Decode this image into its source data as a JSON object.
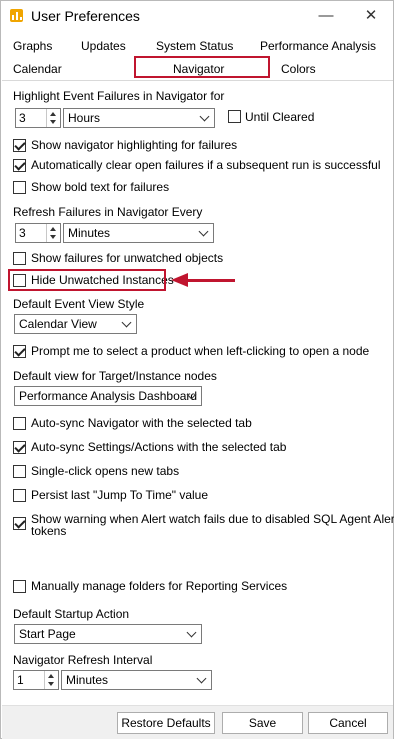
{
  "window": {
    "title": "User Preferences",
    "minimize": "—",
    "close": "✕"
  },
  "tabs": {
    "row1": [
      "Graphs",
      "Updates",
      "System Status",
      "Performance Analysis"
    ],
    "row2": [
      "Calendar",
      "Navigator",
      "Colors"
    ],
    "active": "Navigator"
  },
  "highlight_failures": {
    "label": "Highlight Event Failures in Navigator for",
    "number": "3",
    "unit": "Hours",
    "until_cleared": "Until Cleared",
    "until_cleared_checked": false
  },
  "options_a": [
    {
      "label": "Show navigator highlighting for failures",
      "checked": true
    },
    {
      "label": "Automatically clear open failures if a subsequent run is successful",
      "checked": true
    },
    {
      "label": "Show bold text for failures",
      "checked": false
    }
  ],
  "refresh_failures": {
    "label": "Refresh Failures in Navigator Every",
    "number": "3",
    "unit": "Minutes"
  },
  "options_b": [
    {
      "label": "Show failures for unwatched objects",
      "checked": false
    },
    {
      "label": "Hide Unwatched Instances",
      "checked": false
    }
  ],
  "default_event_view": {
    "label": "Default Event View Style",
    "value": "Calendar View"
  },
  "prompt_product": {
    "label": "Prompt me to select a product when left-clicking to open a node",
    "checked": true
  },
  "default_target_view": {
    "label": "Default view for Target/Instance nodes",
    "value": "Performance Analysis Dashboard"
  },
  "options_c": [
    {
      "label": "Auto-sync Navigator with the selected tab",
      "checked": false
    },
    {
      "label": "Auto-sync Settings/Actions with the selected tab",
      "checked": true
    },
    {
      "label": "Single-click opens new tabs",
      "checked": false
    },
    {
      "label": "Persist last \"Jump To Time\" value",
      "checked": false
    }
  ],
  "alert_warning": {
    "line1": "Show warning when Alert watch fails due to disabled SQL Agent Alert",
    "line2": "tokens",
    "checked": true
  },
  "reporting_services": {
    "label": "Manually manage folders for Reporting Services",
    "checked": false
  },
  "startup_action": {
    "label": "Default Startup Action",
    "value": "Start Page"
  },
  "nav_refresh": {
    "label": "Navigator Refresh Interval",
    "number": "1",
    "unit": "Minutes"
  },
  "footer": {
    "restore": "Restore Defaults",
    "save": "Save",
    "cancel": "Cancel"
  },
  "colors": {
    "highlight": "#c0152f",
    "app_icon": "#f0a500"
  }
}
